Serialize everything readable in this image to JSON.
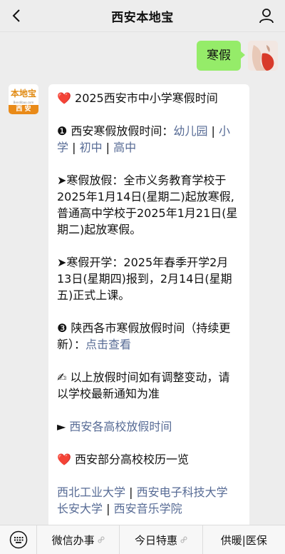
{
  "header": {
    "title": "西安本地宝"
  },
  "outgoing": {
    "text": "寒假"
  },
  "account_logo": {
    "top": "本地宝",
    "url": "Bendibao.com",
    "bottom": "西 安"
  },
  "message": {
    "l1_heart": "❤️",
    "l1_text": " 2025西安市中小学寒假时间",
    "l2_num": "❶",
    "l2_text": " 西安寒假放假时间：",
    "link_kindergarten": "幼儿园",
    "link_primary": "小学",
    "link_junior": "初中",
    "link_senior": "高中",
    "sep": " | ",
    "p3_text": "➤寒假放假：全市义务教育学校于2025年1月14日(星期二)起放寒假,",
    "p3_text2": "普通高中学校于2025年1月21日(星期二)起放寒假。",
    "p4_text": "➤寒假开学：2025年春季开学2月13日(星期四)报到，2月14日(星期五)正式上课。",
    "p5_num": "❸",
    "p5_text": " 陕西各市寒假放假时间（持续更新）：",
    "p5_link": "点击查看",
    "p6_icon": "✍",
    "p6_text": " 以上放假时间如有调整变动，请以学校最新通知为准",
    "p7_arrow": "►",
    "p7_link": " 西安各高校放假时间",
    "p8_heart": "❤️",
    "p8_text": " 西安部分高校校历一览",
    "link_nwpu": "西北工业大学",
    "link_xidian": "西安电子科技大学",
    "link_chd": "长安大学",
    "link_xacm": "西安音乐学院",
    "sep2": " | "
  },
  "bottom_menu": {
    "items": [
      "微信办事",
      "今日特惠",
      "供暖|医保"
    ]
  }
}
